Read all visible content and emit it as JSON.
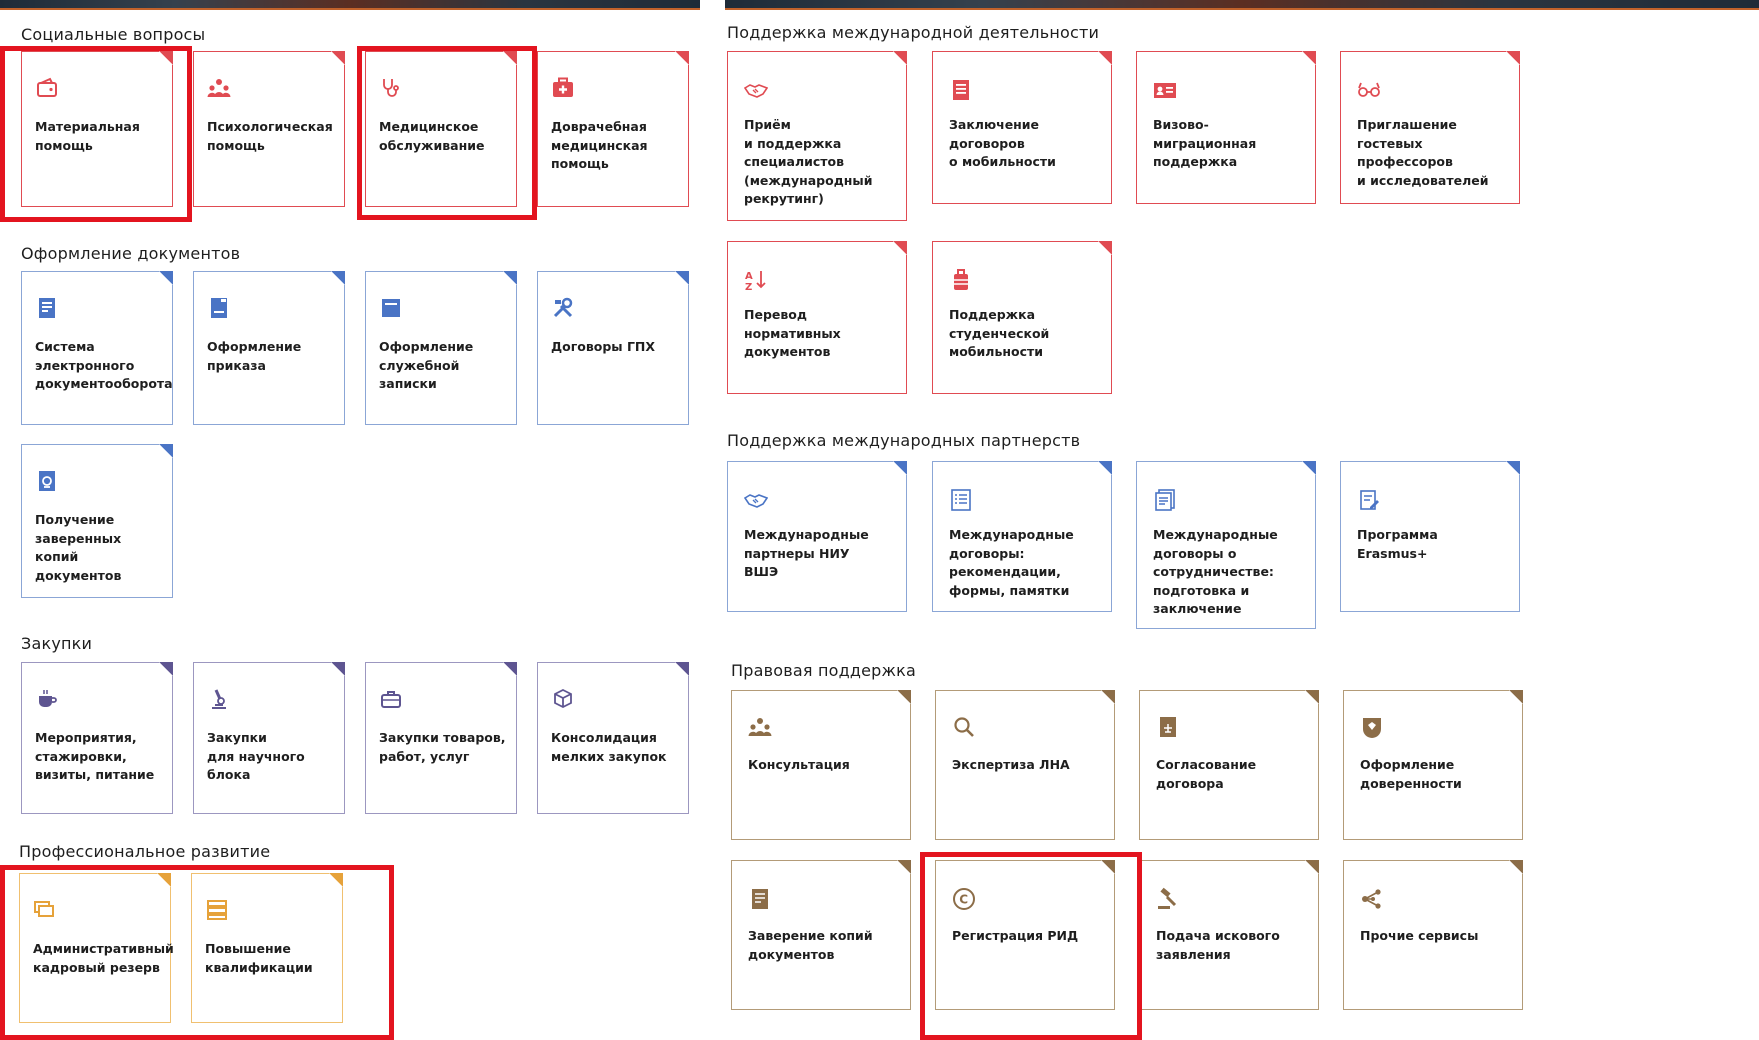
{
  "colors": {
    "social": "#e04b52",
    "docs": "#4a74c5",
    "purchases": "#5e5591",
    "professional": "#e6a23a",
    "legal": "#8c6d48",
    "highlight": "#e3141f"
  },
  "sections": {
    "social": {
      "title": "Социальные вопросы",
      "items": [
        {
          "label": "Материальная\nпомощь",
          "icon": "wallet-icon"
        },
        {
          "label": "Психологическая\nпомощь",
          "icon": "people-group-icon"
        },
        {
          "label": "Медицинское\nобслуживание",
          "icon": "stethoscope-icon"
        },
        {
          "label": "Доврачебная\nмедицинская\nпомощь",
          "icon": "first-aid-kit-icon"
        }
      ]
    },
    "docs": {
      "title": "Оформление документов",
      "items": [
        {
          "label": "Система\nэлектронного\nдокументооборота",
          "icon": "electronic-document-icon"
        },
        {
          "label": "Оформление\nприказа",
          "icon": "order-document-icon"
        },
        {
          "label": "Оформление\nслужебной\nзаписки",
          "icon": "memo-icon"
        },
        {
          "label": "Договоры ГПХ",
          "icon": "tools-icon"
        },
        {
          "label": "Получение\nзаверенных копий\nдокументов",
          "icon": "certified-copy-icon"
        }
      ]
    },
    "purchases": {
      "title": "Закупки",
      "items": [
        {
          "label": "Мероприятия,\nстажировки,\nвизиты, питание",
          "icon": "coffee-cup-icon"
        },
        {
          "label": "Закупки\nдля научного\nблока",
          "icon": "microscope-icon"
        },
        {
          "label": "Закупки товаров,\nработ, услуг",
          "icon": "toolbox-icon"
        },
        {
          "label": "Консолидация\nмелких закупок",
          "icon": "boxes-icon"
        }
      ]
    },
    "professional": {
      "title": "Профессиональное развитие",
      "items": [
        {
          "label": "Административный\nкадровый резерв",
          "icon": "stacked-cards-icon"
        },
        {
          "label": "Повышение\nквалификации",
          "icon": "book-stack-icon"
        }
      ]
    },
    "intl": {
      "title": "Поддержка международной деятельности",
      "items": [
        {
          "label": "Приём\nи поддержка\nспециалистов\n(международный\nрекрутинг)",
          "icon": "handshake-icon"
        },
        {
          "label": "Заключение\nдоговоров\nо мобильности",
          "icon": "contract-icon"
        },
        {
          "label": "Визово-\nмиграционная\nподдержка",
          "icon": "id-card-icon"
        },
        {
          "label": "Приглашение\nгостевых\nпрофессоров\nи исследователей",
          "icon": "glasses-icon"
        },
        {
          "label": "Перевод\nнормативных\nдокументов",
          "icon": "translate-sort-icon"
        },
        {
          "label": "Поддержка\nстуденческой\nмобильности",
          "icon": "suitcase-icon"
        }
      ]
    },
    "partners": {
      "title": "Поддержка международных партнерств",
      "items": [
        {
          "label": "Международные\nпартнеры НИУ\nВШЭ",
          "icon": "handshake-icon"
        },
        {
          "label": "Международные\nдоговоры:\nрекомендации,\nформы, памятки",
          "icon": "checklist-icon"
        },
        {
          "label": "Международные\nдоговоры о\nсотрудничестве:\nподготовка и\nзаключение",
          "icon": "documents-icon"
        },
        {
          "label": "Программа\nErasmus+",
          "icon": "document-edit-icon"
        }
      ]
    },
    "legal": {
      "title": "Правовая поддержка",
      "items": [
        {
          "label": "Консультация",
          "icon": "people-group-icon"
        },
        {
          "label": "Экспертиза ЛНА",
          "icon": "magnifier-icon"
        },
        {
          "label": "Согласование\nдоговора",
          "icon": "scales-document-icon"
        },
        {
          "label": "Оформление\nдоверенности",
          "icon": "emblem-icon"
        },
        {
          "label": "Заверение копий\nдокументов",
          "icon": "certified-copy-icon"
        },
        {
          "label": "Регистрация РИД",
          "icon": "copyright-icon"
        },
        {
          "label": "Подача искового\nзаявления",
          "icon": "gavel-icon"
        },
        {
          "label": "Прочие сервисы",
          "icon": "share-nodes-icon"
        }
      ]
    }
  }
}
